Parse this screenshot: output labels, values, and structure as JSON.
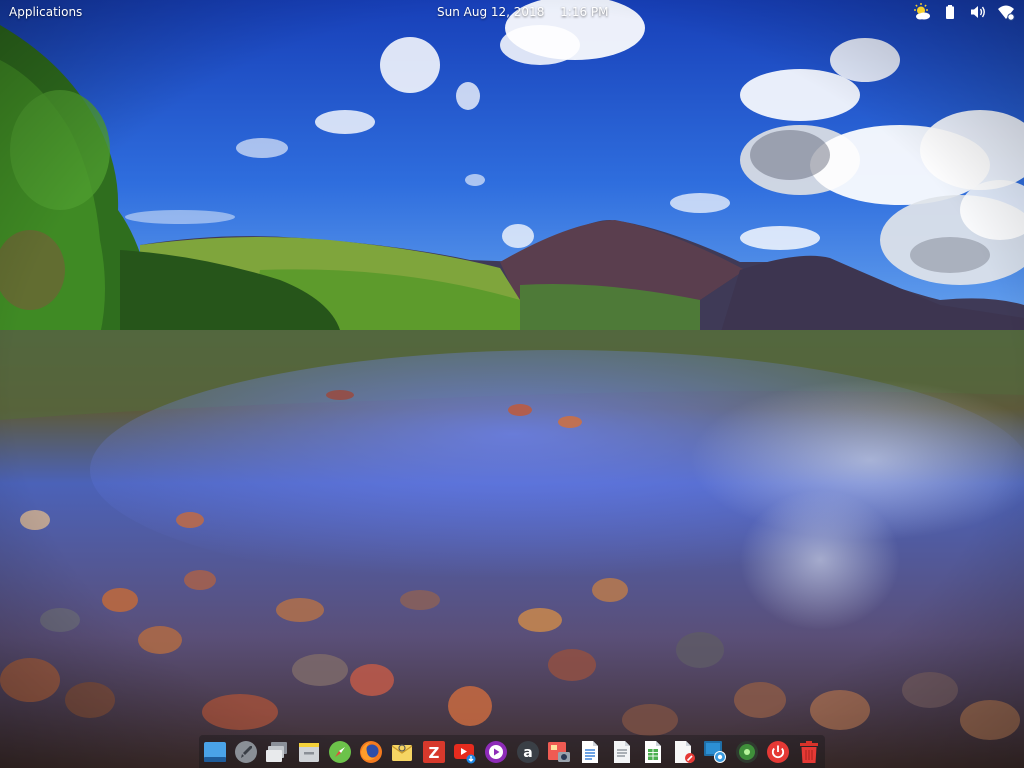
{
  "topbar": {
    "applications_label": "Applications",
    "date": "Sun Aug 12, 2018",
    "time": "1:16 PM"
  },
  "indicators": [
    {
      "icon": "weather-sun-icon"
    },
    {
      "icon": "battery-icon"
    },
    {
      "icon": "volume-icon"
    },
    {
      "icon": "network-wireless-icon"
    }
  ],
  "dock": {
    "items": [
      {
        "icon": "show-desktop-icon"
      },
      {
        "icon": "rocket-launcher-icon"
      },
      {
        "icon": "multitasking-view-icon"
      },
      {
        "icon": "file-manager-icon"
      },
      {
        "icon": "web-browser-icon"
      },
      {
        "icon": "firefox-icon"
      },
      {
        "icon": "mail-icon"
      },
      {
        "icon": "filezilla-icon"
      },
      {
        "icon": "youtube-downloader-icon"
      },
      {
        "icon": "music-player-icon"
      },
      {
        "icon": "amazon-icon"
      },
      {
        "icon": "screenshot-icon"
      },
      {
        "icon": "document-writer-icon"
      },
      {
        "icon": "text-document-icon"
      },
      {
        "icon": "spreadsheet-icon"
      },
      {
        "icon": "text-editor-icon"
      },
      {
        "icon": "remote-desktop-icon"
      },
      {
        "icon": "system-monitor-icon"
      },
      {
        "icon": "shutdown-icon"
      },
      {
        "icon": "trash-icon"
      }
    ]
  }
}
